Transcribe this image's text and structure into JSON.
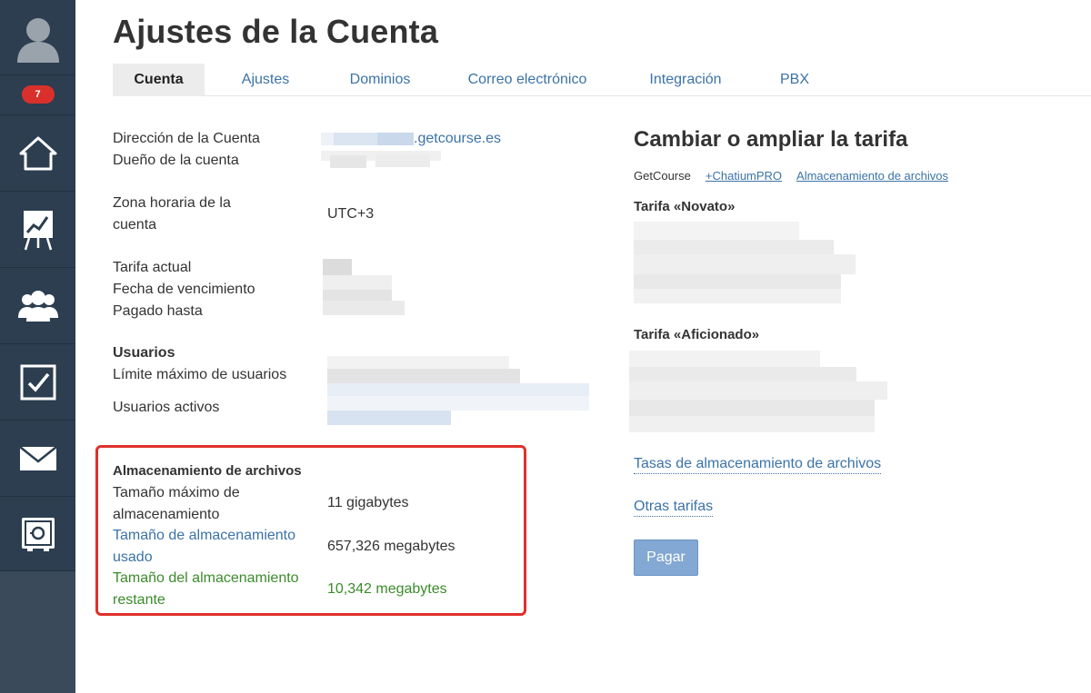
{
  "sidebar": {
    "badge_count": "7",
    "items": [
      {
        "icon": "home-icon"
      },
      {
        "icon": "chart-icon"
      },
      {
        "icon": "users-icon"
      },
      {
        "icon": "tasks-icon"
      },
      {
        "icon": "mail-icon"
      },
      {
        "icon": "safe-icon"
      }
    ]
  },
  "page": {
    "title": "Ajustes de la Cuenta"
  },
  "tabs": [
    {
      "label": "Cuenta",
      "active": true
    },
    {
      "label": "Ajustes"
    },
    {
      "label": "Dominios"
    },
    {
      "label": "Correo electrónico"
    },
    {
      "label": "Integración"
    },
    {
      "label": "PBX"
    }
  ],
  "account": {
    "address_label": "Dirección de la Cuenta",
    "address_suffix": ".getcourse.es",
    "owner_label": "Dueño de la cuenta",
    "timezone_label_1": "Zona horaria de la",
    "timezone_label_2": "cuenta",
    "timezone_value": "UTC+3",
    "tariff_label": "Tarifa actual",
    "expiry_label": "Fecha de vencimiento",
    "paid_label": "Pagado hasta",
    "users_heading": "Usuarios",
    "users_limit_label": "Límite máximo de usuarios",
    "users_active_label": "Usuarios activos"
  },
  "storage": {
    "heading": "Almacenamiento de archivos",
    "max_label_1": "Tamaño máximo de",
    "max_label_2": "almacenamiento",
    "max_value": "11 gigabytes",
    "used_label_1": "Tamaño de almacenamiento",
    "used_label_2": "usado",
    "used_value": "657,326 megabytes",
    "remaining_label_1": "Tamaño del almacenamiento",
    "remaining_label_2": "restante",
    "remaining_value": "10,342 megabytes"
  },
  "tariffs": {
    "title": "Cambiar o ampliar la tarifa",
    "subnav_current": "GetCourse",
    "subnav_links": [
      "+ChatiumPRO",
      "Almacenamiento de archivos"
    ],
    "tariff_1": "Tarifa «Novato»",
    "tariff_2": "Tarifa «Aficionado»",
    "storage_rates_link": "Tasas de almacenamiento de archivos",
    "other_tariffs_link": "Otras tarifas",
    "pay_button": "Pagar"
  },
  "colors": {
    "sidebar": "#2c3e50",
    "link": "#3b73a8",
    "green": "#3a8c2a",
    "highlight": "#e0302b",
    "pay_button": "#82a8d3"
  }
}
